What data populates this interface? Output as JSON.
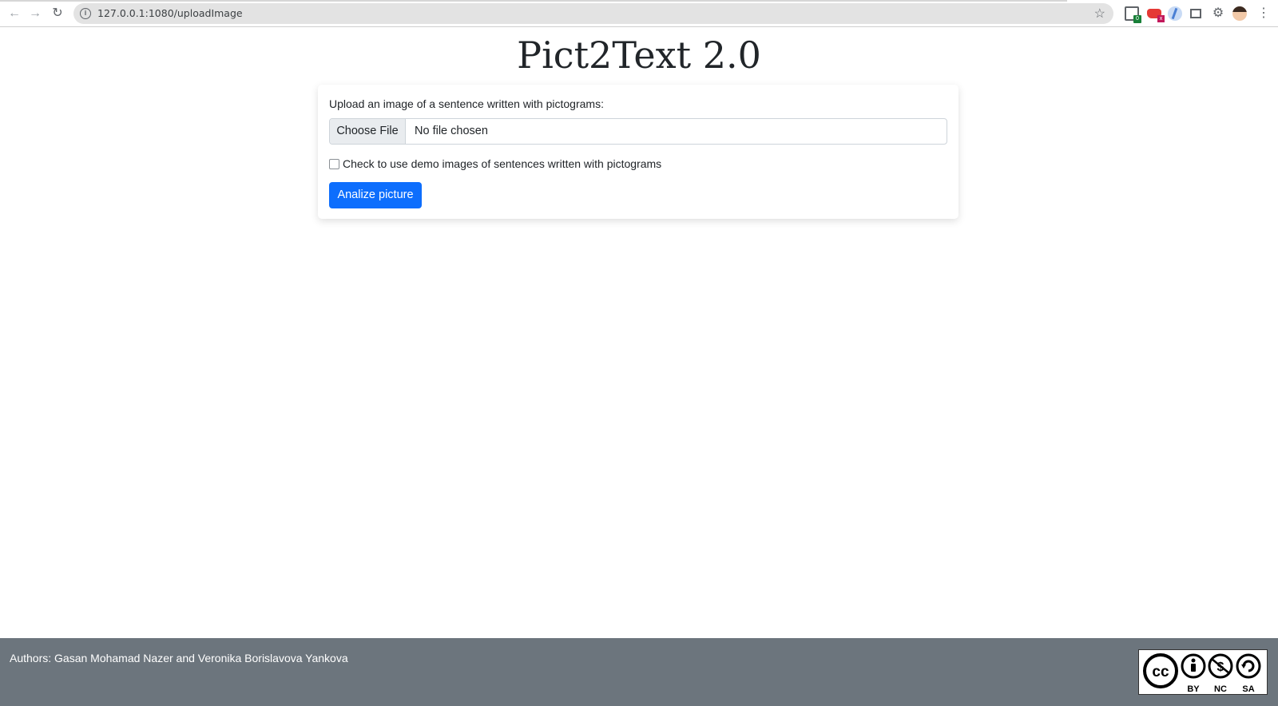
{
  "browser": {
    "url": "127.0.0.1:1080/uploadImage",
    "extension_badges": [
      "0",
      "x"
    ]
  },
  "page": {
    "title": "Pict2Text 2.0"
  },
  "upload_form": {
    "label": "Upload an image of a sentence written with pictograms:",
    "choose_file_label": "Choose File",
    "file_status": "No file chosen",
    "demo_checkbox_label": "Check to use demo images of sentences written with pictograms",
    "demo_checked": false,
    "submit_label": "Analize picture"
  },
  "footer": {
    "authors": "Authors: Gasan Mohamad Nazer and Veronika Borislavova Yankova",
    "license_labels": [
      "BY",
      "NC",
      "SA"
    ],
    "license_logo_text": "cc"
  },
  "colors": {
    "primary_button": "#0d6efd",
    "footer_bg": "#6c757d",
    "title_text": "#212529"
  }
}
